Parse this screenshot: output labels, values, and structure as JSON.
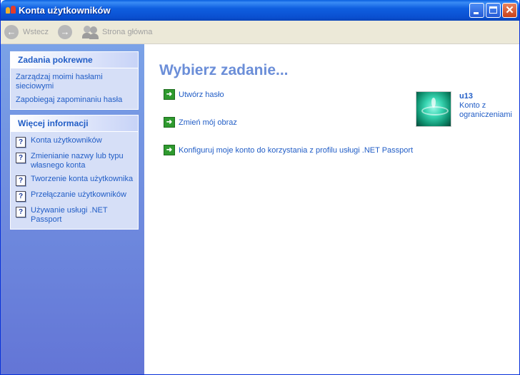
{
  "window": {
    "title": "Konta użytkowników"
  },
  "toolbar": {
    "back_label": "Wstecz",
    "home_label": "Strona główna"
  },
  "sidebar": {
    "related_tasks": {
      "title": "Zadania pokrewne",
      "items": [
        {
          "label": "Zarządzaj moimi hasłami sieciowymi"
        },
        {
          "label": "Zapobiegaj zapominaniu hasła"
        }
      ]
    },
    "more_info": {
      "title": "Więcej informacji",
      "items": [
        {
          "label": "Konta użytkowników",
          "icon": "help-icon"
        },
        {
          "label": "Zmienianie nazwy lub typu własnego konta",
          "icon": "help-icon"
        },
        {
          "label": "Tworzenie konta użytkownika",
          "icon": "help-icon"
        },
        {
          "label": "Przełączanie użytkowników",
          "icon": "help-icon"
        },
        {
          "label": "Używanie usługi .NET Passport",
          "icon": "help-icon"
        }
      ]
    }
  },
  "main": {
    "heading": "Wybierz zadanie...",
    "tasks": [
      {
        "label": "Utwórz hasło",
        "icon": "green-arrow-icon"
      },
      {
        "label": "Zmień mój obraz",
        "icon": "green-arrow-icon"
      },
      {
        "label": "Konfiguruj moje konto do korzystania z profilu usługi .NET Passport",
        "icon": "green-arrow-icon"
      }
    ],
    "user": {
      "name": "u13",
      "account_type": "Konto z ograniczeniami",
      "picture": "water-drop-picture"
    }
  },
  "colors": {
    "titlebar": "#0a4fd0",
    "link": "#215dc6",
    "heading": "#6b8ed8",
    "task_arrow": "#2e9a2e",
    "sidebar": "#6f8fe0"
  }
}
